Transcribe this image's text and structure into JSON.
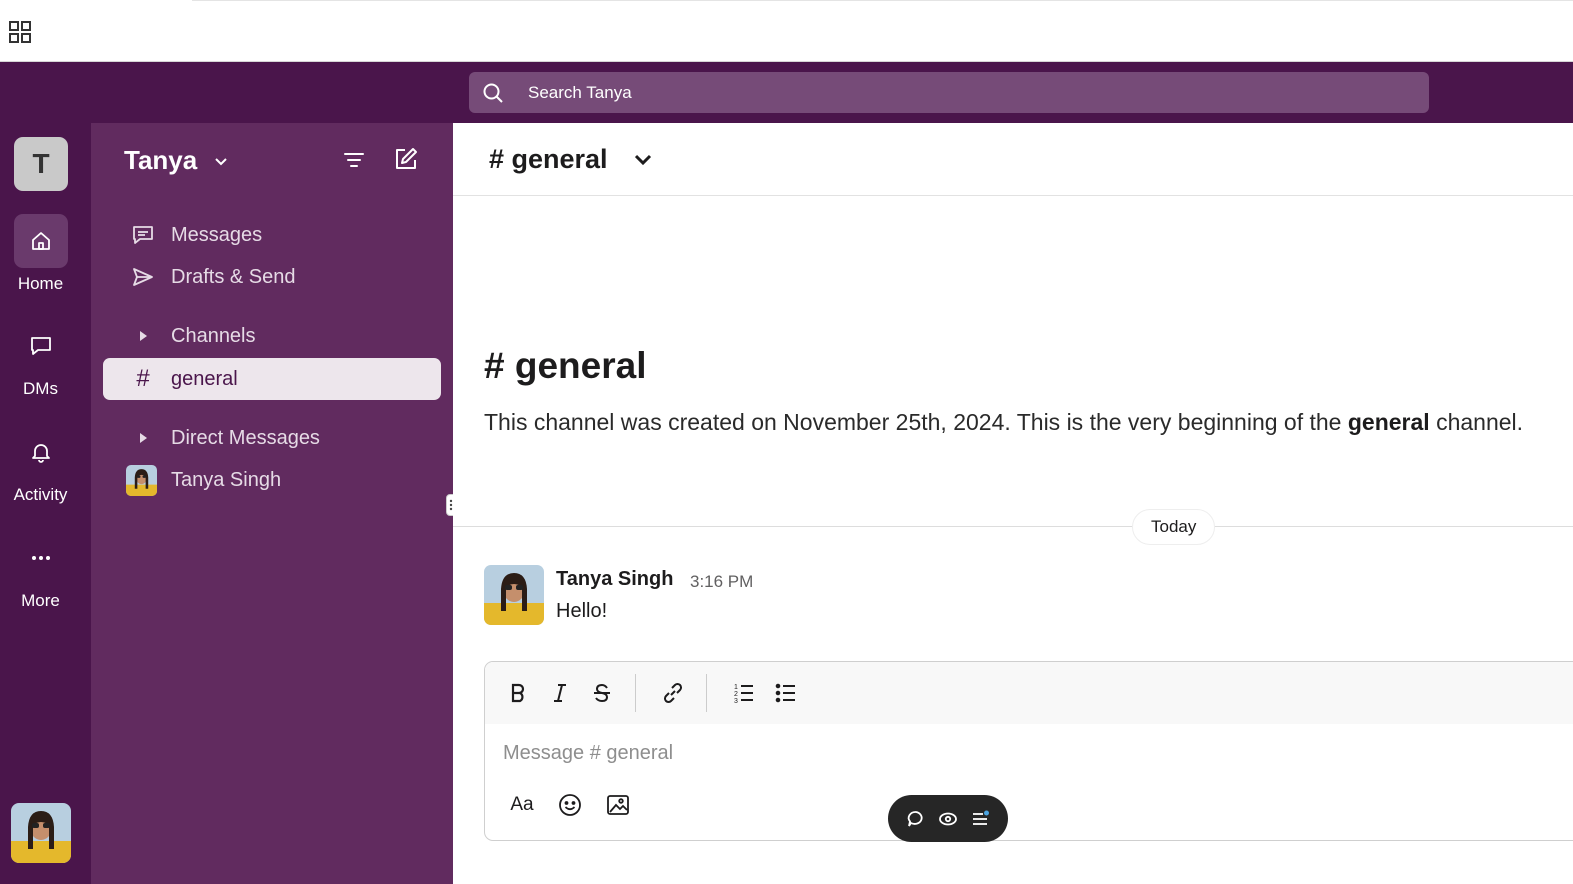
{
  "search": {
    "placeholder": "Search Tanya"
  },
  "workspace": {
    "initial": "T",
    "name": "Tanya"
  },
  "rail": {
    "items": [
      {
        "label": "Home",
        "icon": "home-icon",
        "active": true
      },
      {
        "label": "DMs",
        "icon": "chat-bubble-icon"
      },
      {
        "label": "Activity",
        "icon": "bell-icon"
      },
      {
        "label": "More",
        "icon": "more-dots-icon"
      }
    ]
  },
  "sidebar": {
    "nav": [
      {
        "label": "Messages",
        "icon": "messages-icon"
      },
      {
        "label": "Drafts & Send",
        "icon": "send-icon"
      }
    ],
    "channels_header": "Channels",
    "channels": [
      {
        "label": "general",
        "selected": true
      }
    ],
    "dm_header": "Direct Messages",
    "dms": [
      {
        "label": "Tanya Singh"
      }
    ]
  },
  "channel": {
    "title": "# general",
    "intro_title": "# general",
    "intro_prefix": "This channel was created on November 25th, 2024. This is the very beginning of the ",
    "intro_bold": "general",
    "intro_suffix": " channel."
  },
  "divider_label": "Today",
  "messages": [
    {
      "author": "Tanya Singh",
      "time": "3:16 PM",
      "text": "Hello!"
    }
  ],
  "composer": {
    "placeholder": "Message # general",
    "format_toggle": "Aa"
  },
  "colors": {
    "aubergine": "#4a154b",
    "sidebar": "#612b5f",
    "search_bg": "#764b78",
    "selected_row": "#ede6ec"
  }
}
